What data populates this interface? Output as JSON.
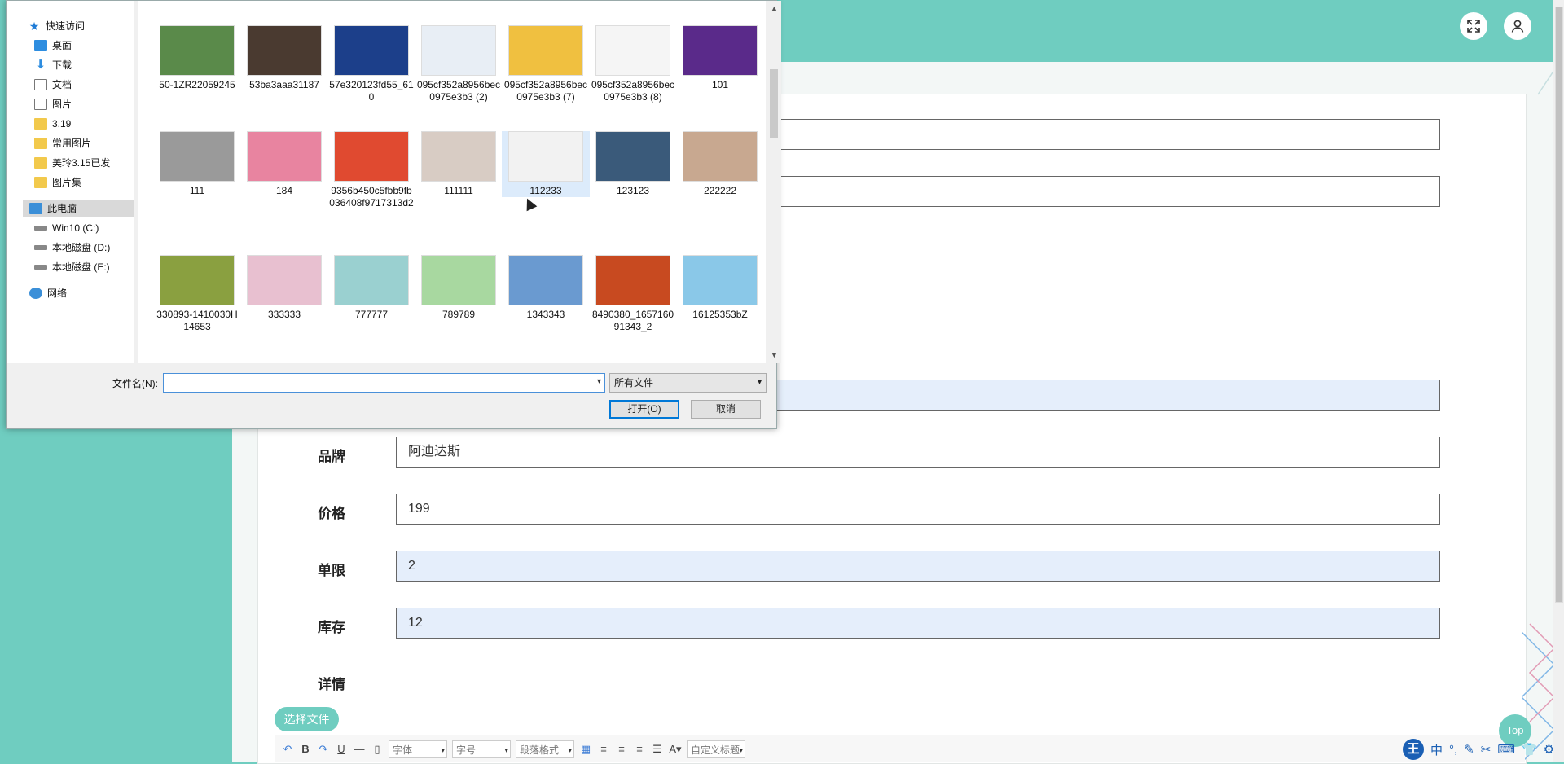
{
  "dialog": {
    "nav": {
      "quick_access": "快速访问",
      "items": [
        {
          "label": "桌面",
          "pinned": true,
          "icon": "desktop-icon"
        },
        {
          "label": "下载",
          "pinned": true,
          "icon": "download-icon"
        },
        {
          "label": "文档",
          "pinned": true,
          "icon": "document-icon"
        },
        {
          "label": "图片",
          "pinned": true,
          "icon": "pictures-icon"
        },
        {
          "label": "3.19",
          "icon": "folder-icon"
        },
        {
          "label": "常用图片",
          "icon": "folder-icon"
        },
        {
          "label": "美玲3.15已发",
          "icon": "folder-icon"
        },
        {
          "label": "图片集",
          "icon": "folder-icon"
        }
      ],
      "this_pc": "此电脑",
      "drives": [
        "Win10 (C:)",
        "本地磁盘 (D:)",
        "本地磁盘 (E:)"
      ],
      "network": "网络"
    },
    "files": [
      {
        "name": "50-1ZR22059245",
        "color": "#5a8a4a"
      },
      {
        "name": "53ba3aaa31187",
        "color": "#4a3a30"
      },
      {
        "name": "57e320123fd55_610",
        "color": "#1c3f8a"
      },
      {
        "name": "095cf352a8956bec0975e3b3 (2)",
        "color": "#e8eef5"
      },
      {
        "name": "095cf352a8956bec0975e3b3 (7)",
        "color": "#f0c040"
      },
      {
        "name": "095cf352a8956bec0975e3b3 (8)",
        "color": "#f5f5f5"
      },
      {
        "name": "101",
        "color": "#5a2a8a"
      },
      {
        "name": "111",
        "color": "#9a9a9a"
      },
      {
        "name": "184",
        "color": "#e884a0"
      },
      {
        "name": "9356b450c5fbb9fb036408f9717313d2",
        "color": "#e04a30"
      },
      {
        "name": "111111",
        "color": "#d8ccc4"
      },
      {
        "name": "112233",
        "color": "#f2f2f2"
      },
      {
        "name": "123123",
        "color": "#3a5a7a"
      },
      {
        "name": "222222",
        "color": "#c8a890"
      },
      {
        "name": "330893-1410030H14653",
        "color": "#8aa040"
      },
      {
        "name": "333333",
        "color": "#e8c0d0"
      },
      {
        "name": "777777",
        "color": "#9ad0d0"
      },
      {
        "name": "789789",
        "color": "#a8d8a0"
      },
      {
        "name": "1343343",
        "color": "#6a9ad0"
      },
      {
        "name": "8490380_165716091343_2",
        "color": "#c84a20"
      },
      {
        "name": "16125353bZ",
        "color": "#8ac8e8"
      }
    ],
    "selected_file": "112233",
    "filename_label": "文件名(N):",
    "filename_value": "",
    "filter": "所有文件",
    "open_button": "打开(O)",
    "cancel_button": "取消"
  },
  "form": {
    "fields": [
      {
        "label": "",
        "value": "",
        "tinted": false
      },
      {
        "label": "",
        "value": "",
        "tinted": false
      },
      {
        "label": "",
        "value": "",
        "tinted": true
      },
      {
        "label": "品牌",
        "value": "阿迪达斯",
        "tinted": false
      },
      {
        "label": "价格",
        "value": "199",
        "tinted": false
      },
      {
        "label": "单限",
        "value": "2",
        "tinted": true
      },
      {
        "label": "库存",
        "value": "12",
        "tinted": true
      }
    ],
    "details_label": "详情",
    "choose_file": "选择文件",
    "editor": {
      "font": "字体",
      "size": "字号",
      "paragraph": "段落格式",
      "custom_title": "自定义标题"
    }
  },
  "top_button": "Top",
  "ime": {
    "logo": "王",
    "mode": "中"
  },
  "colors": {
    "accent": "#6fcdc0",
    "tinted_field": "#e5eefb",
    "primary_border": "#0078d7"
  }
}
